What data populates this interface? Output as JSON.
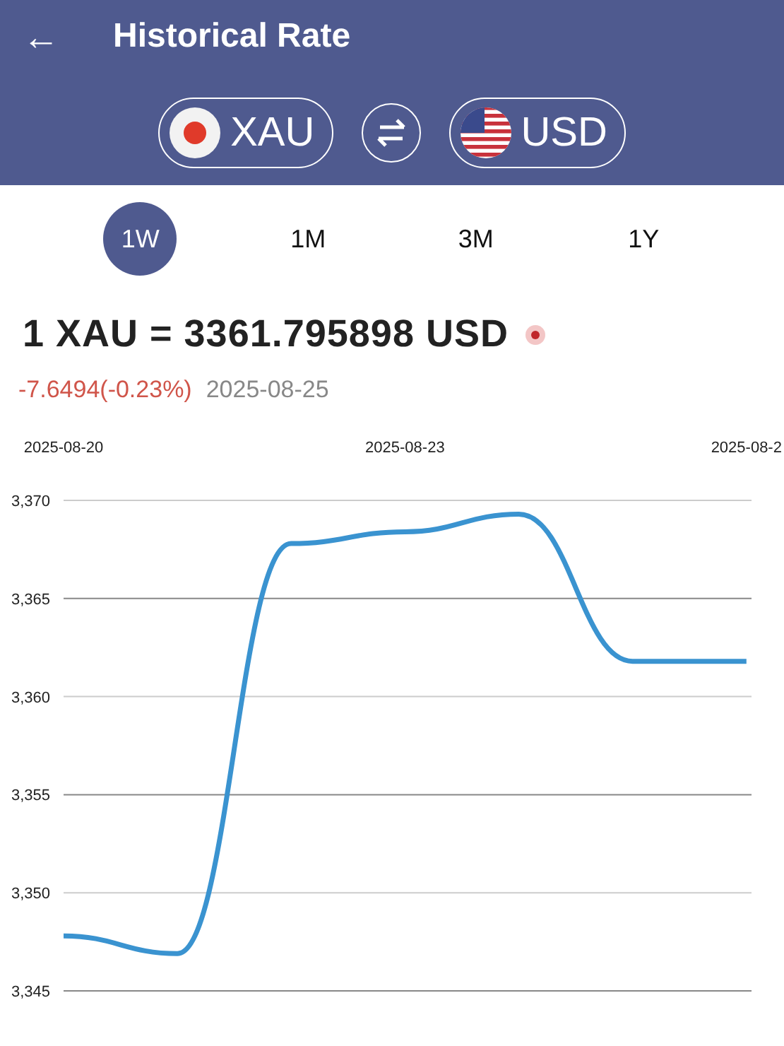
{
  "app_bar": {
    "back_icon": "←",
    "title": "Historical Rate"
  },
  "pair": {
    "from": {
      "code": "XAU"
    },
    "to": {
      "code": "USD"
    }
  },
  "periods": [
    {
      "label": "1W",
      "selected": true
    },
    {
      "label": "1M",
      "selected": false
    },
    {
      "label": "3M",
      "selected": false
    },
    {
      "label": "1Y",
      "selected": false
    }
  ],
  "rate": {
    "text": "1 XAU = 3361.795898 USD",
    "change": "-7.6494(-0.23%)",
    "date": "2025-08-25"
  },
  "chart_data": {
    "type": "line",
    "categories": [
      "2025-08-20",
      null,
      null,
      "2025-08-23",
      null,
      null,
      "2025-08-2"
    ],
    "series": [
      {
        "color": "#3a93d0",
        "values": [
          3347.8,
          3346.9,
          3367.8,
          3368.4,
          3369.3,
          3361.8,
          3361.8
        ]
      }
    ],
    "ylim": [
      3345,
      3370
    ],
    "grid": true,
    "yticks": [
      {
        "value": 3345,
        "label": "3,345"
      },
      {
        "value": 3350,
        "label": "3,350"
      },
      {
        "value": 3355,
        "label": "3,355"
      },
      {
        "value": 3360,
        "label": "3,360"
      },
      {
        "value": 3365,
        "label": "3,365"
      },
      {
        "value": 3370,
        "label": "3,370"
      }
    ]
  }
}
